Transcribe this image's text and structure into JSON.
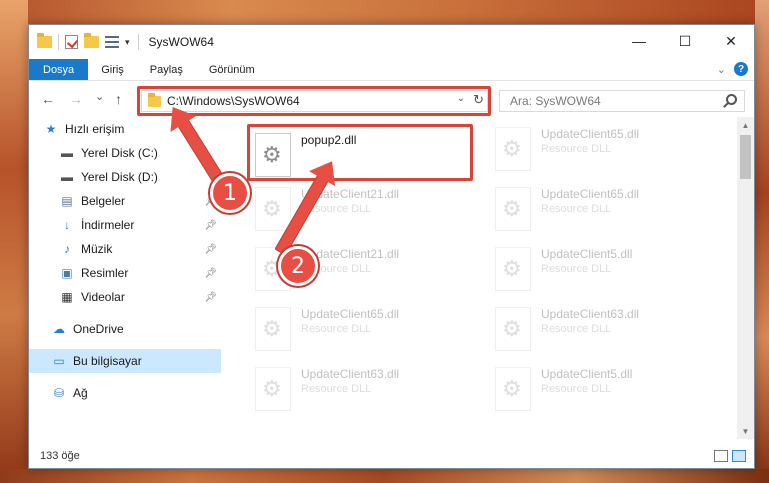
{
  "window": {
    "title": "SysWOW64",
    "controls": {
      "minimize": "—",
      "maximize": "☐",
      "close": "✕"
    }
  },
  "ribbon": {
    "tabs": [
      {
        "label": "Dosya"
      },
      {
        "label": "Giriş"
      },
      {
        "label": "Paylaş"
      },
      {
        "label": "Görünüm"
      }
    ],
    "help": "?"
  },
  "nav_buttons": {
    "back": "←",
    "forward": "→",
    "recent": "⌄",
    "up": "↑"
  },
  "address": {
    "path": "C:\\Windows\\SysWOW64",
    "search_placeholder": "Ara: SysWOW64"
  },
  "sidebar": {
    "items": [
      {
        "label": "Hızlı erişim"
      },
      {
        "label": "Yerel Disk (C:)"
      },
      {
        "label": "Yerel Disk (D:)"
      },
      {
        "label": "Belgeler"
      },
      {
        "label": "İndirmeler"
      },
      {
        "label": "Müzik"
      },
      {
        "label": "Resimler"
      },
      {
        "label": "Videolar"
      },
      {
        "label": "OneDrive"
      },
      {
        "label": "Bu bilgisayar"
      },
      {
        "label": "Ağ"
      }
    ]
  },
  "files": [
    {
      "name": "popup2.dll",
      "desc": ""
    },
    {
      "name": "UpdateClient65.dll",
      "desc": "Resource DLL"
    },
    {
      "name": "UpdateClient21.dll",
      "desc": "Resource DLL"
    },
    {
      "name": "UpdateClient65.dll",
      "desc": "Resource DLL"
    },
    {
      "name": "UpdateClient21.dll",
      "desc": "Resource DLL"
    },
    {
      "name": "UpdateClient5.dll",
      "desc": "Resource DLL"
    },
    {
      "name": "UpdateClient65.dll",
      "desc": "Resource DLL"
    },
    {
      "name": "UpdateClient63.dll",
      "desc": "Resource DLL"
    },
    {
      "name": "UpdateClient63.dll",
      "desc": "Resource DLL"
    },
    {
      "name": "UpdateClient5.dll",
      "desc": "Resource DLL"
    }
  ],
  "status": {
    "count": "133 öğe"
  },
  "callouts": {
    "one": "1",
    "two": "2"
  },
  "colors": {
    "accent": "#1979ca",
    "highlight": "#d9443a",
    "selection": "#cce8ff"
  }
}
